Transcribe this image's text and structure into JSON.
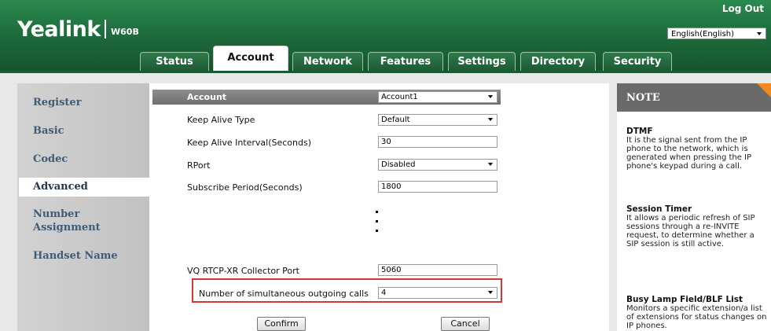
{
  "header": {
    "brand": "Yealink",
    "model": "W60B",
    "logout": "Log Out",
    "language": "English(English)"
  },
  "tabs": [
    {
      "label": "Status"
    },
    {
      "label": "Account"
    },
    {
      "label": "Network"
    },
    {
      "label": "Features"
    },
    {
      "label": "Settings"
    },
    {
      "label": "Directory"
    },
    {
      "label": "Security"
    }
  ],
  "sidebar": {
    "items": [
      {
        "label": "Register"
      },
      {
        "label": "Basic"
      },
      {
        "label": "Codec"
      },
      {
        "label": "Advanced"
      },
      {
        "label": "Number Assignment"
      },
      {
        "label": "Handset Name"
      }
    ],
    "active": "Advanced"
  },
  "form": {
    "account_label": "Account",
    "account_value": "Account1",
    "keep_alive_type_label": "Keep Alive Type",
    "keep_alive_type_value": "Default",
    "keep_alive_interval_label": "Keep Alive Interval(Seconds)",
    "keep_alive_interval_value": "30",
    "rport_label": "RPort",
    "rport_value": "Disabled",
    "subscribe_period_label": "Subscribe Period(Seconds)",
    "subscribe_period_value": "1800",
    "vq_port_label": "VQ RTCP-XR Collector Port",
    "vq_port_value": "5060",
    "simultaneous_calls_label": "Number of simultaneous outgoing calls",
    "simultaneous_calls_value": "4",
    "confirm_label": "Confirm",
    "cancel_label": "Cancel"
  },
  "note": {
    "title": "NOTE",
    "dtmf_title": "DTMF",
    "dtmf_text": "It is the signal sent from the IP phone to the network, which is generated when pressing the IP phone's keypad during a call.",
    "session_timer_title": "Session Timer",
    "session_timer_text": "It allows a periodic refresh of SIP sessions through a re-INVITE request, to determine whether a SIP session is still active.",
    "blf_title": "Busy Lamp Field/BLF List",
    "blf_text": "Monitors a specific extension/a list of extensions for status changes on IP phones."
  },
  "colors": {
    "header_green": "#1f6e3e",
    "sidebar_text": "#3e5b78",
    "highlight_red": "#d13838",
    "note_corner": "#f28b1f"
  }
}
